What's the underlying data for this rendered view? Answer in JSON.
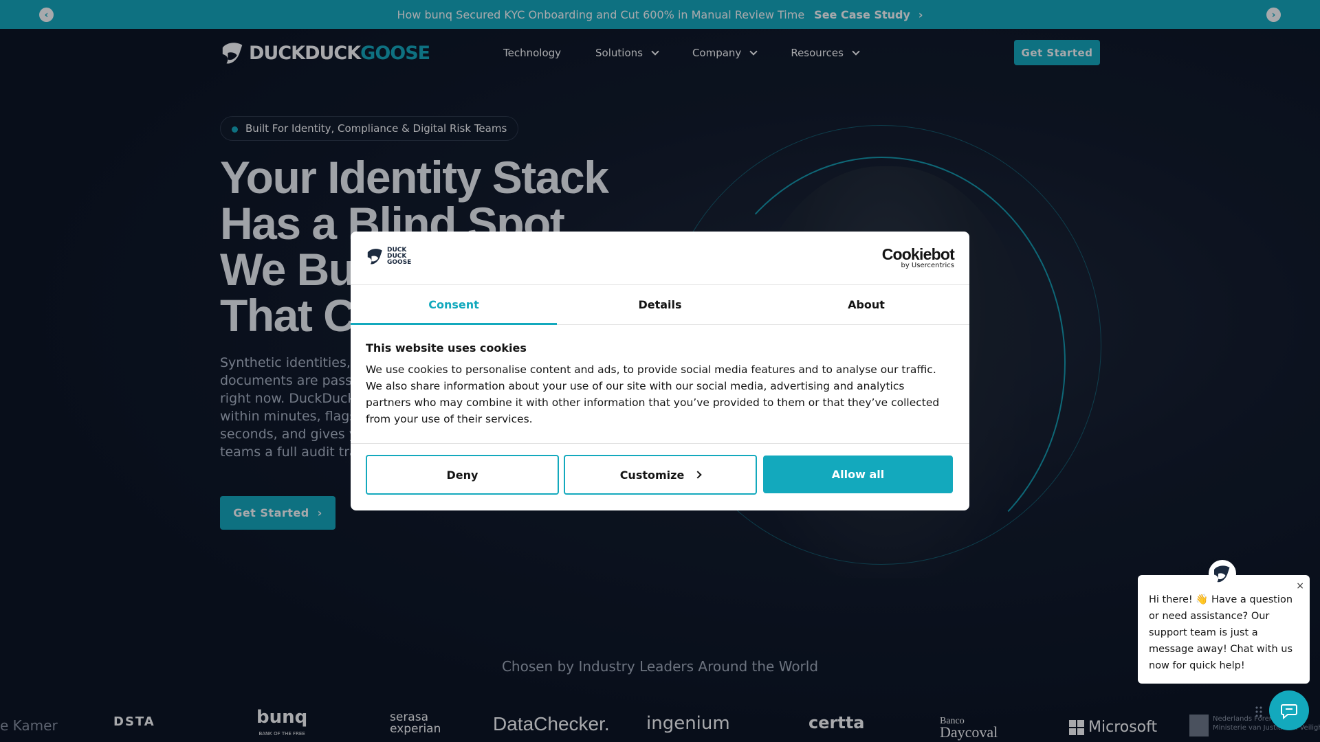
{
  "announcement": {
    "message": "How bunq Secured KYC Onboarding and Cut 600% in Manual Review Time",
    "cta": "See Case Study"
  },
  "nav": {
    "logo_part1": "DUCKDUCK",
    "logo_part2": "GOOSE",
    "items": [
      {
        "label": "Technology",
        "dropdown": false
      },
      {
        "label": "Solutions",
        "dropdown": true
      },
      {
        "label": "Company",
        "dropdown": true
      },
      {
        "label": "Resources",
        "dropdown": true
      }
    ],
    "cta": "Get Started"
  },
  "hero": {
    "pill": "Built For Identity, Compliance & Digital Risk Teams",
    "headline_lines": [
      "Your Identity Stack",
      "Has a Blind Spot",
      "We Bu",
      "That C"
    ],
    "sub_lines": [
      "Synthetic identities,",
      "documents are passi",
      "right now. DuckDuck",
      "within minutes, flags",
      "seconds, and gives y",
      "teams a full audit tra"
    ],
    "cta": "Get Started"
  },
  "cookie_dialog": {
    "logo_lines": [
      "DUCK",
      "DUCK",
      "GOOSE"
    ],
    "provider_name": "Cookiebot",
    "provider_sub": "by Usercentrics",
    "tabs": [
      {
        "label": "Consent",
        "active": true
      },
      {
        "label": "Details",
        "active": false
      },
      {
        "label": "About",
        "active": false
      }
    ],
    "title": "This website uses cookies",
    "body": "We use cookies to personalise content and ads, to provide social media features and to analyse our traffic. We also share information about your use of our site with our social media, advertising and analytics partners who may combine it with other information that you’ve provided to them or that they’ve collected from your use of their services.",
    "buttons": {
      "deny": "Deny",
      "customize": "Customize",
      "allow": "Allow all"
    }
  },
  "chosen": "Chosen by Industry Leaders Around the World",
  "logos": {
    "kamer": "e Kamer",
    "dsta": "DSTA",
    "bunq": "bunq",
    "bunq_sub": "BANK OF THE FREE",
    "serasa_1": "serasa",
    "serasa_2": "experian",
    "datachecker": "DataChecker.",
    "ingenium": "ingenium",
    "certta": "certta",
    "banco_1": "Banco",
    "banco_2": "Daycoval",
    "microsoft": "Microsoft",
    "nl_1": "Nederlands Forensisch",
    "nl_2": "Ministerie van Justitie en Veiligheid"
  },
  "chat": {
    "message": "Hi there! 👋 Have a question or need assistance? Our support team is just a message away! Chat with us now for quick help!",
    "close": "×"
  },
  "colors": {
    "accent": "#13a9bd",
    "background": "#0b1220"
  }
}
